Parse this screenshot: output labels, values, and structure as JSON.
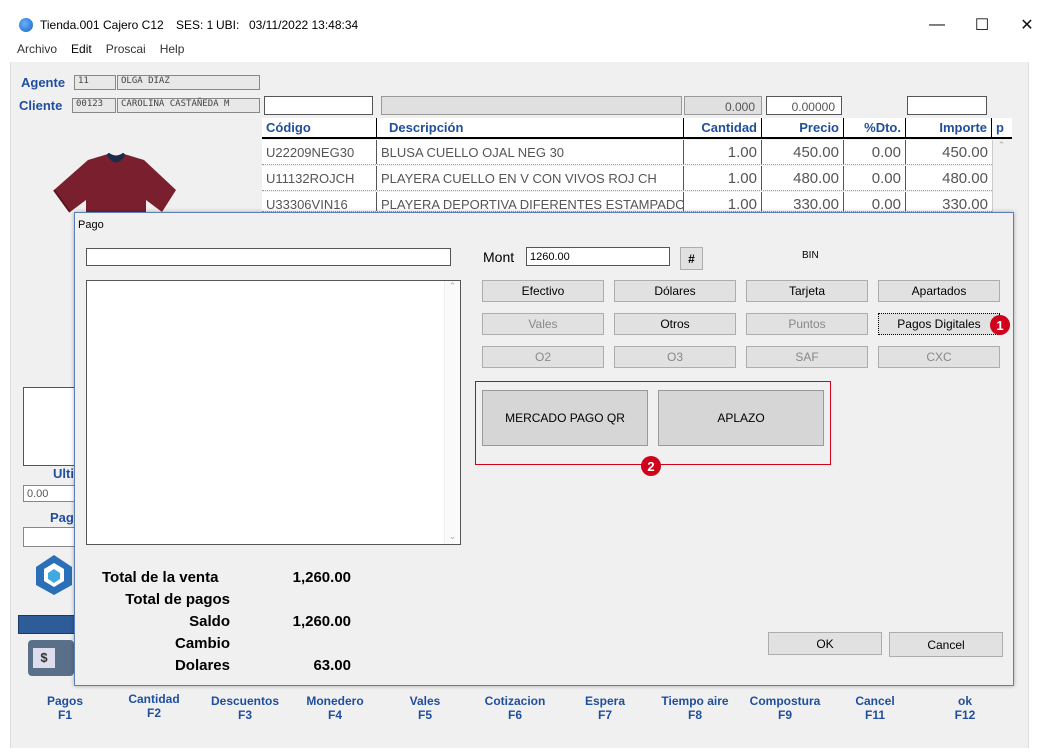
{
  "window": {
    "title_store": "Tienda.001",
    "title_cashier": "Cajero C12",
    "title_ses": "SES: 1",
    "title_ubi": "UBI:",
    "title_datetime": "03/11/2022 13:48:34"
  },
  "menu": [
    "Archivo",
    "Edit",
    "Proscai",
    "Help"
  ],
  "agent": {
    "label": "Agente",
    "code": "11",
    "name": "OLGA DIAZ"
  },
  "client": {
    "label": "Cliente",
    "code": "00123",
    "name": "CAROLINA CASTAÑEDA M"
  },
  "toprow": {
    "val1": "0.000",
    "val2": "0.00000"
  },
  "grid": {
    "headers": [
      "Código",
      "Descripción",
      "Cantidad",
      "Precio",
      "%Dto.",
      "Importe",
      "p"
    ],
    "rows": [
      {
        "code": "U22209NEG30",
        "desc": "BLUSA CUELLO OJAL NEG 30",
        "qty": "1.00",
        "price": "450.00",
        "dto": "0.00",
        "imp": "450.00"
      },
      {
        "code": "U11132ROJCH",
        "desc": "PLAYERA CUELLO EN V CON VIVOS ROJ CH",
        "qty": "1.00",
        "price": "480.00",
        "dto": "0.00",
        "imp": "480.00"
      },
      {
        "code": "U33306VIN16",
        "desc": "PLAYERA DEPORTIVA DIFERENTES ESTAMPADOS VI",
        "qty": "1.00",
        "price": "330.00",
        "dto": "0.00",
        "imp": "330.00"
      }
    ]
  },
  "left": {
    "ulti": "Ulti",
    "ulti_val": "0.00",
    "pag": "Pag"
  },
  "dialog": {
    "title": "Pago",
    "mont_label": "Mont",
    "mont_value": "1260.00",
    "hash": "#",
    "bin": "BIN",
    "buttons": [
      {
        "label": "Efectivo",
        "enabled": true
      },
      {
        "label": "Dólares",
        "enabled": true
      },
      {
        "label": "Tarjeta",
        "enabled": true
      },
      {
        "label": "Apartados",
        "enabled": true
      },
      {
        "label": "Vales",
        "enabled": false
      },
      {
        "label": "Otros",
        "enabled": true
      },
      {
        "label": "Puntos",
        "enabled": false
      },
      {
        "label": "Pagos Digitales",
        "enabled": true
      },
      {
        "label": "O2",
        "enabled": false
      },
      {
        "label": "O3",
        "enabled": false
      },
      {
        "label": "SAF",
        "enabled": false
      },
      {
        "label": "CXC",
        "enabled": false
      }
    ],
    "digital": [
      "MERCADO PAGO QR",
      "APLAZO"
    ],
    "totals": [
      {
        "label": "Total de la venta",
        "value": "1,260.00"
      },
      {
        "label": "Total de pagos",
        "value": ""
      },
      {
        "label": "Saldo",
        "value": "1,260.00"
      },
      {
        "label": "Cambio",
        "value": ""
      },
      {
        "label": "Dolares",
        "value": "63.00"
      }
    ],
    "ok": "OK",
    "cancel": "Cancel"
  },
  "badges": [
    "1",
    "2"
  ],
  "fkeys": [
    {
      "name": "Pagos",
      "key": "F1"
    },
    {
      "name": "Cantidad",
      "key": "F2"
    },
    {
      "name": "Descuentos",
      "key": "F3"
    },
    {
      "name": "Monedero",
      "key": "F4"
    },
    {
      "name": "Vales",
      "key": "F5"
    },
    {
      "name": "Cotizacion",
      "key": "F6"
    },
    {
      "name": "Espera",
      "key": "F7"
    },
    {
      "name": "Tiempo aire",
      "key": "F8"
    },
    {
      "name": "Compostura",
      "key": "F9"
    },
    {
      "name": "Cancel",
      "key": "F11"
    },
    {
      "name": "ok",
      "key": "F12"
    }
  ],
  "colors": {
    "accent": "#1f4e9e",
    "badge": "#d0021b",
    "highlight_border": "#d0021b"
  }
}
